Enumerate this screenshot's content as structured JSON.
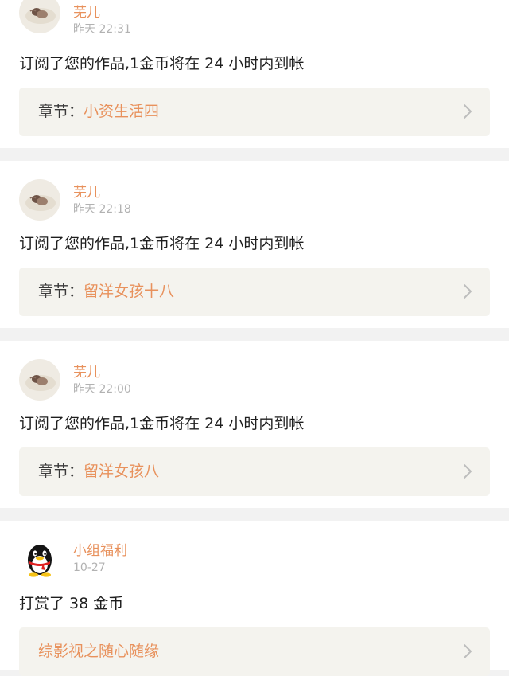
{
  "notifications": [
    {
      "avatar": "profile-photo",
      "username": "芜儿",
      "time": "昨天 22:31",
      "message": "订阅了您的作品,1金币将在 24 小时内到帐",
      "link_prefix": "章节：",
      "link_title": "小资生活四"
    },
    {
      "avatar": "profile-photo",
      "username": "芜儿",
      "time": "昨天 22:18",
      "message": "订阅了您的作品,1金币将在 24 小时内到帐",
      "link_prefix": "章节：",
      "link_title": "留洋女孩十八"
    },
    {
      "avatar": "profile-photo",
      "username": "芜儿",
      "time": "昨天 22:00",
      "message": "订阅了您的作品,1金币将在 24 小时内到帐",
      "link_prefix": "章节：",
      "link_title": "留洋女孩八"
    },
    {
      "avatar": "penguin-icon",
      "username": "小组福利",
      "time": "10-27",
      "message": "打赏了 38 金币",
      "link_prefix": "",
      "link_title": "综影视之随心随缘"
    }
  ],
  "colors": {
    "accent": "#e8915c",
    "timestamp": "#b2b2b2",
    "link_background": "#f4f3ee",
    "separator": "#f2f2f2"
  }
}
